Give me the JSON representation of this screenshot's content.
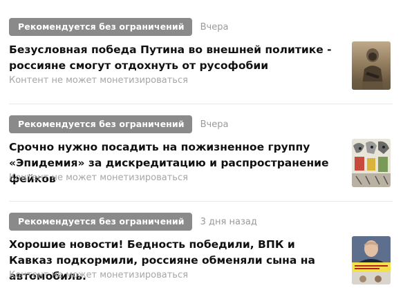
{
  "items": [
    {
      "badge": "Рекомендуется без ограничений",
      "date": "Вчера",
      "title": "Безусловная победа Путина во внешней политике - россияне смогут отдохнуть от русофобии",
      "note": "Контент не может монетизироваться",
      "thumb_icon": "soldier-photo-icon"
    },
    {
      "badge": "Рекомендуется без ограничений",
      "date": "Вчера",
      "title": "Срочно нужно посадить на пожизненное группу «Эпидемия» за дискредитацию и распространение фейков",
      "note": "Контент не может монетизироваться",
      "thumb_icon": "cartoon-image-icon"
    },
    {
      "badge": "Рекомендуется без ограничений",
      "date": "3 дня назад",
      "title": "Хорошие новости! Бедность победили, ВПК и Кавказ подкормили, россияне обменяли сына на автомобиль.",
      "note": "Контент не может монетизироваться",
      "thumb_icon": "politician-photo-icon"
    }
  ],
  "colors": {
    "badge_bg": "#8a8a8a",
    "badge_text": "#ffffff",
    "date_text": "#9a9a9a",
    "title_text": "#111111",
    "note_text": "#a6a6a6",
    "divider": "#e8e8e8"
  }
}
